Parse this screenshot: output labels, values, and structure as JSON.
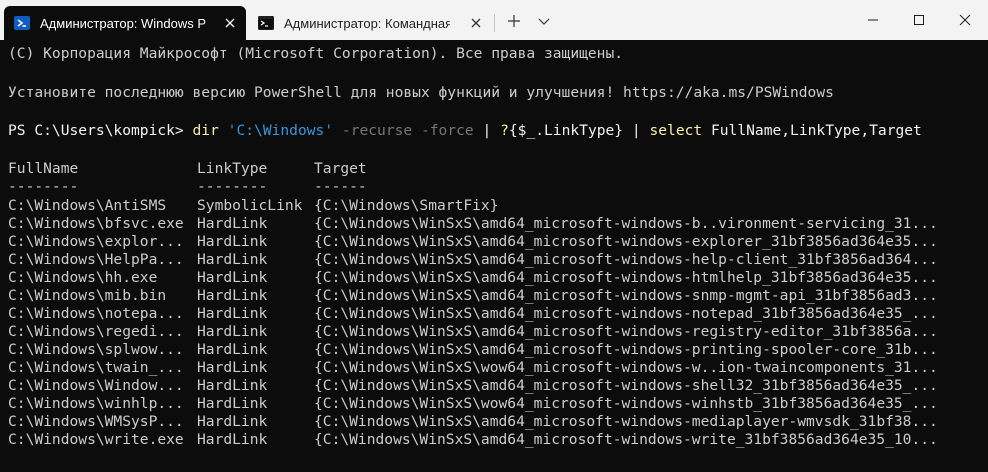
{
  "tabs": [
    {
      "label": "Администратор: Windows Pow",
      "icon": "powershell-icon",
      "active": true
    },
    {
      "label": "Администратор: Командная ст",
      "icon": "cmd-icon",
      "active": false
    }
  ],
  "colors": {
    "background": "#0c0c0c",
    "foreground": "#cccccc",
    "command": "#f9f1a5",
    "string": "#3a96dd",
    "parameter": "#767676",
    "accent_tab_icon": "#0f5dbf"
  },
  "terminal": {
    "copyright": "(C) Корпорация Майкрософт (Microsoft Corporation). Все права защищены.",
    "update_notice": "Установите последнюю версию PowerShell для новых функций и улучшения! https://aka.ms/PSWindows",
    "command": {
      "prompt": "PS C:\\Users\\kompick> ",
      "cmd": "dir",
      "path": "'C:\\Windows'",
      "params": "-recurse -force",
      "pipe1": "| ",
      "filter_cmd": "?",
      "filter_expr": "{$_.LinkType}",
      "pipe2": " | ",
      "select_cmd": "select",
      "select_args": " FullName,LinkType,Target"
    },
    "headers": [
      "FullName",
      "LinkType",
      "Target"
    ],
    "separators": [
      "--------",
      "--------",
      "------"
    ],
    "rows": [
      {
        "full": "C:\\Windows\\AntiSMS",
        "type": "SymbolicLink",
        "target": "{C:\\Windows\\SmartFix}"
      },
      {
        "full": "C:\\Windows\\bfsvc.exe",
        "type": "HardLink",
        "target": "{C:\\Windows\\WinSxS\\amd64_microsoft-windows-b..vironment-servicing_31..."
      },
      {
        "full": "C:\\Windows\\explor...",
        "type": "HardLink",
        "target": "{C:\\Windows\\WinSxS\\amd64_microsoft-windows-explorer_31bf3856ad364e35..."
      },
      {
        "full": "C:\\Windows\\HelpPa...",
        "type": "HardLink",
        "target": "{C:\\Windows\\WinSxS\\amd64_microsoft-windows-help-client_31bf3856ad364..."
      },
      {
        "full": "C:\\Windows\\hh.exe",
        "type": "HardLink",
        "target": "{C:\\Windows\\WinSxS\\amd64_microsoft-windows-htmlhelp_31bf3856ad364e35..."
      },
      {
        "full": "C:\\Windows\\mib.bin",
        "type": "HardLink",
        "target": "{C:\\Windows\\WinSxS\\amd64_microsoft-windows-snmp-mgmt-api_31bf3856ad3..."
      },
      {
        "full": "C:\\Windows\\notepa...",
        "type": "HardLink",
        "target": "{C:\\Windows\\WinSxS\\amd64_microsoft-windows-notepad_31bf3856ad364e35_..."
      },
      {
        "full": "C:\\Windows\\regedi...",
        "type": "HardLink",
        "target": "{C:\\Windows\\WinSxS\\amd64_microsoft-windows-registry-editor_31bf3856a..."
      },
      {
        "full": "C:\\Windows\\splwow...",
        "type": "HardLink",
        "target": "{C:\\Windows\\WinSxS\\amd64_microsoft-windows-printing-spooler-core_31b..."
      },
      {
        "full": "C:\\Windows\\twain_...",
        "type": "HardLink",
        "target": "{C:\\Windows\\WinSxS\\wow64_microsoft-windows-w..ion-twaincomponents_31..."
      },
      {
        "full": "C:\\Windows\\Window...",
        "type": "HardLink",
        "target": "{C:\\Windows\\WinSxS\\amd64_microsoft-windows-shell32_31bf3856ad364e35_..."
      },
      {
        "full": "C:\\Windows\\winhlp...",
        "type": "HardLink",
        "target": "{C:\\Windows\\WinSxS\\wow64_microsoft-windows-winhstb_31bf3856ad364e35_..."
      },
      {
        "full": "C:\\Windows\\WMSysP...",
        "type": "HardLink",
        "target": "{C:\\Windows\\WinSxS\\amd64_microsoft-windows-mediaplayer-wmvsdk_31bf38..."
      },
      {
        "full": "C:\\Windows\\write.exe",
        "type": "HardLink",
        "target": "{C:\\Windows\\WinSxS\\amd64_microsoft-windows-write_31bf3856ad364e35_10..."
      }
    ]
  }
}
